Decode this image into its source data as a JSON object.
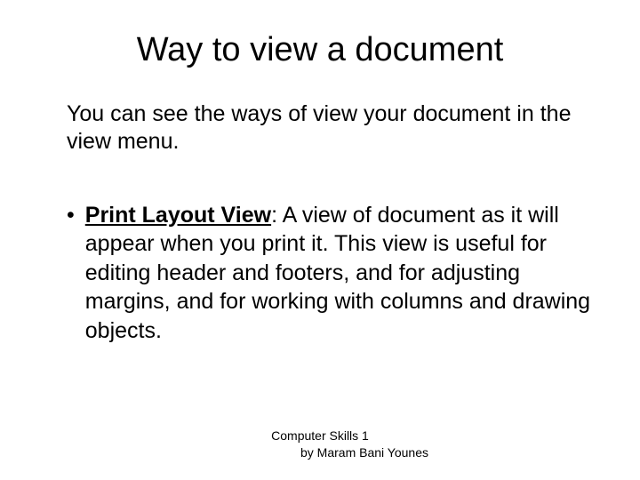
{
  "title": "Way to view a document",
  "intro": "You can see the ways of view your document in the view menu.",
  "bullet": {
    "term": "Print Layout View",
    "separator": ": ",
    "description": "A view of document as it will appear when you print it. This view is useful for editing header and footers, and for adjusting margins, and for working with columns and drawing objects."
  },
  "footer": {
    "line1": "Computer Skills 1",
    "line2": "by Maram Bani Younes"
  }
}
